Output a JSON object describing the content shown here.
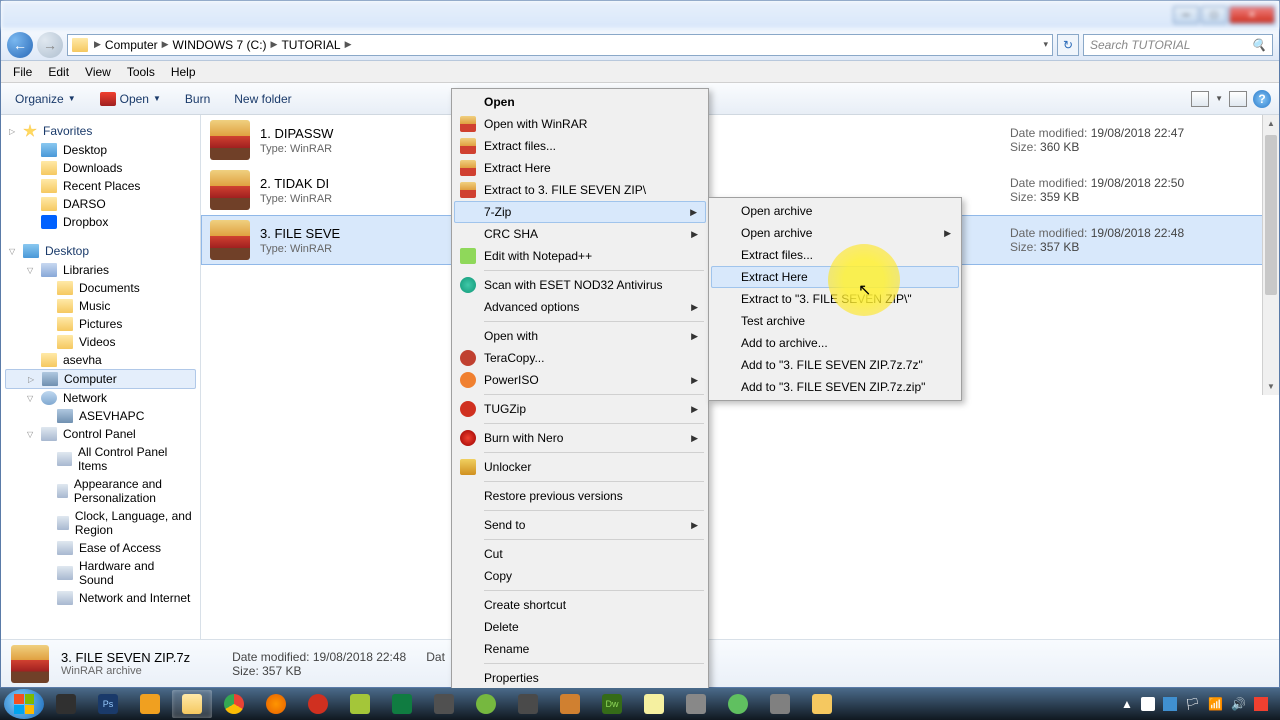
{
  "title_controls": {
    "min": "─",
    "max": "□",
    "close": "✕"
  },
  "breadcrumbs": [
    "Computer",
    "WINDOWS 7 (C:)",
    "TUTORIAL"
  ],
  "search": {
    "placeholder": "Search TUTORIAL"
  },
  "menubar": [
    "File",
    "Edit",
    "View",
    "Tools",
    "Help"
  ],
  "toolbar": {
    "organize": "Organize",
    "open": "Open",
    "burn": "Burn",
    "newfolder": "New folder"
  },
  "sidebar": {
    "favorites": {
      "label": "Favorites",
      "items": [
        "Desktop",
        "Downloads",
        "Recent Places",
        "DARSO",
        "Dropbox"
      ]
    },
    "desktop": {
      "label": "Desktop",
      "libraries": {
        "label": "Libraries",
        "items": [
          "Documents",
          "Music",
          "Pictures",
          "Videos"
        ]
      },
      "user": "asevha",
      "computer": {
        "label": "Computer"
      },
      "network": {
        "label": "Network",
        "items": [
          "ASEVHAPC"
        ]
      },
      "cpanel": {
        "label": "Control Panel",
        "items": [
          "All Control Panel Items",
          "Appearance and Personalization",
          "Clock, Language, and Region",
          "Ease of Access",
          "Hardware and Sound",
          "Network and Internet"
        ]
      }
    }
  },
  "files": [
    {
      "name": "1. DIPASSW",
      "type": "Type: WinRAR",
      "mod_lbl": "Date modified:",
      "mod": "19/08/2018 22:47",
      "size_lbl": "Size:",
      "size": "360 KB"
    },
    {
      "name": "2. TIDAK DI",
      "type": "Type: WinRAR",
      "mod_lbl": "Date modified:",
      "mod": "19/08/2018 22:50",
      "size_lbl": "Size:",
      "size": "359 KB"
    },
    {
      "name": "3. FILE SEVE",
      "type": "Type: WinRAR",
      "mod_lbl": "Date modified:",
      "mod": "19/08/2018 22:48",
      "size_lbl": "Size:",
      "size": "357 KB"
    }
  ],
  "details": {
    "name": "3. FILE SEVEN ZIP.7z",
    "sub": "WinRAR archive",
    "mod_lbl": "Date modified:",
    "mod": "19/08/2018 22:48",
    "size_lbl": "Size:",
    "size": "357 KB",
    "created_lbl": "Dat"
  },
  "context_menu_1": {
    "open": "Open",
    "open_winrar": "Open with WinRAR",
    "extract_files": "Extract files...",
    "extract_here": "Extract Here",
    "extract_to": "Extract to 3. FILE SEVEN ZIP\\",
    "seven_zip": "7-Zip",
    "crc_sha": "CRC SHA",
    "edit_npp": "Edit with Notepad++",
    "scan_eset": "Scan with ESET NOD32 Antivirus",
    "adv_opt": "Advanced options",
    "open_with": "Open with",
    "teracopy": "TeraCopy...",
    "poweriso": "PowerISO",
    "tugzip": "TUGZip",
    "burn_nero": "Burn with Nero",
    "unlocker": "Unlocker",
    "restore": "Restore previous versions",
    "send_to": "Send to",
    "cut": "Cut",
    "copy": "Copy",
    "shortcut": "Create shortcut",
    "delete": "Delete",
    "rename": "Rename",
    "properties": "Properties"
  },
  "context_menu_2": {
    "open_archive": "Open archive",
    "open_archive2": "Open archive",
    "extract_files": "Extract files...",
    "extract_here": "Extract Here",
    "extract_to": "Extract to \"3. FILE SEVEN ZIP\\\"",
    "test": "Test archive",
    "add_archive": "Add to archive...",
    "add_7z": "Add to \"3. FILE SEVEN ZIP.7z.7z\"",
    "add_zip": "Add to \"3. FILE SEVEN ZIP.7z.zip\""
  },
  "taskbar": {
    "time": ""
  }
}
